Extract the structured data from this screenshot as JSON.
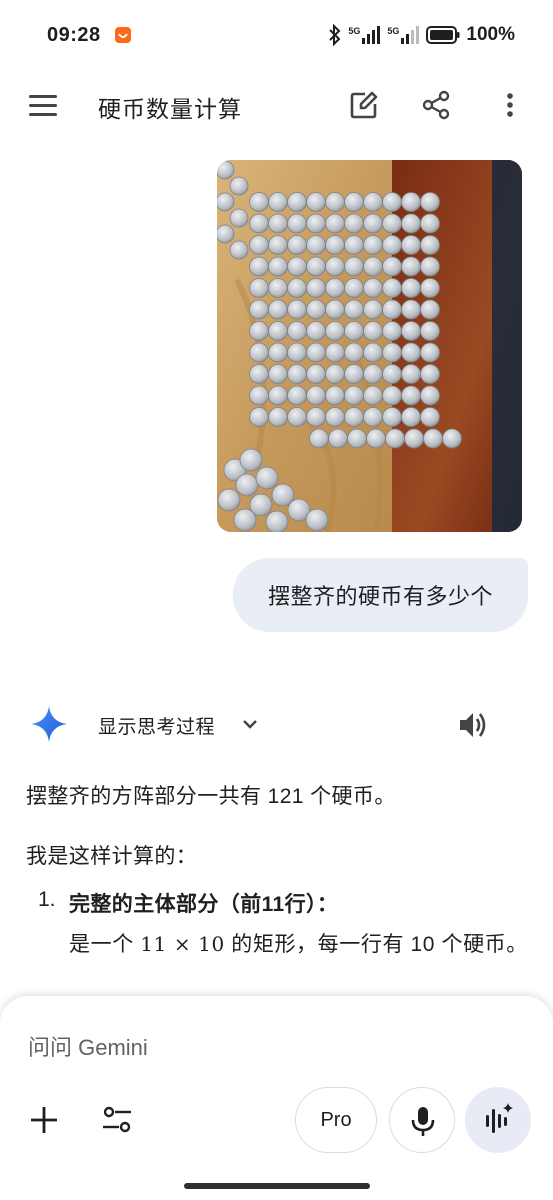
{
  "status": {
    "time": "09:28",
    "battery": "100%",
    "signal1_label": "5G",
    "signal2_label": "5G"
  },
  "app_bar": {
    "title": "硬币数量计算",
    "icons": [
      "menu-icon",
      "edit-icon",
      "share-icon",
      "more-vert-icon"
    ]
  },
  "user_message": {
    "text": "摆整齐的硬币有多少个"
  },
  "response": {
    "thinking_label": "显示思考过程",
    "p1_prefix": "摆整齐的方阵部分一共有 ",
    "p1_number": "121",
    "p1_suffix": " 个硬币。",
    "p2": "我是这样计算的：",
    "list_num": "1.",
    "list_title": "完整的主体部分（前11行）：",
    "list_body_prefix": "是一个 ",
    "list_body_math": "11 × 10",
    "list_body_suffix": " 的矩形，每一行有 10 个硬币。"
  },
  "composer": {
    "placeholder": "问问 Gemini",
    "pro_label": "Pro"
  },
  "colors": {
    "bubble": "#e9eef6",
    "gemini_blue": "#4285f4",
    "text": "#1f1f1f"
  }
}
